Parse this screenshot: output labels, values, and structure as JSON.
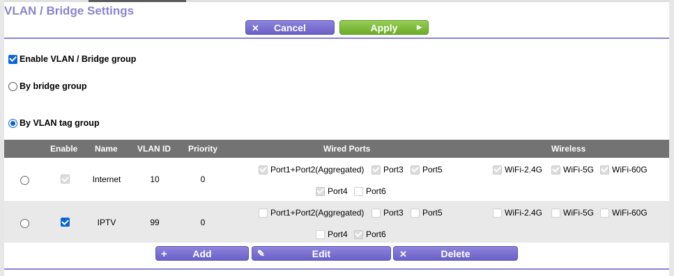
{
  "title": "VLAN / Bridge Settings",
  "top_buttons": {
    "cancel": "Cancel",
    "apply": "Apply"
  },
  "options": {
    "enable_label": "Enable VLAN / Bridge group",
    "bridge_label": "By bridge group",
    "vlan_label": "By VLAN tag group",
    "enable_checked": true,
    "selected_mode": "vlan"
  },
  "table": {
    "headers": {
      "enable": "Enable",
      "name": "Name",
      "vlan_id": "VLAN ID",
      "priority": "Priority",
      "wired": "Wired Ports",
      "wireless": "Wireless"
    },
    "rows": [
      {
        "name": "Internet",
        "vlan_id": "10",
        "priority": "0",
        "enabled": true,
        "ports": {
          "p12": "Port1+Port2(Aggregated)",
          "p3": "Port3",
          "p5": "Port5",
          "p4": "Port4",
          "p6": "Port6"
        },
        "wireless": {
          "w24": "WiFi-2.4G",
          "w5": "WiFi-5G",
          "w60": "WiFi-60G"
        }
      },
      {
        "name": "IPTV",
        "vlan_id": "99",
        "priority": "0",
        "enabled": true,
        "ports": {
          "p12": "Port1+Port2(Aggregated)",
          "p3": "Port3",
          "p5": "Port5",
          "p4": "Port4",
          "p6": "Port6"
        },
        "wireless": {
          "w24": "WiFi-2.4G",
          "w5": "WiFi-5G",
          "w60": "WiFi-60G"
        }
      }
    ]
  },
  "bottom_buttons": {
    "add": "Add",
    "edit": "Edit",
    "delete": "Delete"
  },
  "colors": {
    "accent": "#8a83d2",
    "button_purple": "#6a60c8",
    "button_green": "#6cab2a",
    "header_gray": "#737373"
  },
  "icons": {
    "cancel": "x-icon",
    "apply": "arrow-right-icon",
    "add": "plus-icon",
    "edit": "pencil-icon",
    "delete": "x-icon"
  }
}
